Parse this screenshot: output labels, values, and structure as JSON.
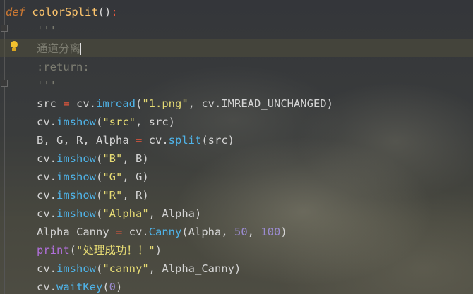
{
  "editor": {
    "lines": [
      {
        "def_kw": "def",
        "func_name": "colorSplit",
        "parens": "()",
        "colon": ":"
      },
      {
        "doc": "'''"
      },
      {
        "doc": "通道分离"
      },
      {
        "doc": ":return:"
      },
      {
        "doc": "'''"
      },
      {
        "var": "src",
        "eq": " = ",
        "obj": "cv.",
        "method": "imread",
        "open": "(",
        "str": "\"1.png\"",
        "rest": ", cv.IMREAD_UNCHANGED)"
      },
      {
        "obj": "cv.",
        "method": "imshow",
        "open": "(",
        "str": "\"src\"",
        "rest": ", src)"
      },
      {
        "var": "B, G, R, Alpha",
        "eq": " = ",
        "obj": "cv.",
        "method": "split",
        "rest": "(src)"
      },
      {
        "obj": "cv.",
        "method": "imshow",
        "open": "(",
        "str": "\"B\"",
        "rest": ", B)"
      },
      {
        "obj": "cv.",
        "method": "imshow",
        "open": "(",
        "str": "\"G\"",
        "rest": ", G)"
      },
      {
        "obj": "cv.",
        "method": "imshow",
        "open": "(",
        "str": "\"R\"",
        "rest": ", R)"
      },
      {
        "obj": "cv.",
        "method": "imshow",
        "open": "(",
        "str": "\"Alpha\"",
        "rest": ", Alpha)"
      },
      {
        "var": "Alpha_Canny",
        "eq": " = ",
        "obj": "cv.",
        "method": "Canny",
        "args_a": "(Alpha, ",
        "n1": "50",
        "sep": ", ",
        "n2": "100",
        "close": ")"
      },
      {
        "builtin": "print",
        "open": "(",
        "str": "\"处理成功！！\"",
        "close": ")"
      },
      {
        "obj": "cv.",
        "method": "imshow",
        "open": "(",
        "str": "\"canny\"",
        "rest": ", Alpha_Canny)"
      },
      {
        "obj": "cv.",
        "method": "waitKey",
        "open": "(",
        "n1": "0",
        "close": ")"
      }
    ],
    "gutter_icons": [
      "fold-icon",
      "intention-bulb-icon",
      "fold-icon"
    ],
    "colors": {
      "keyword": "#cc7832",
      "function_name": "#ffc66d",
      "docstring": "#7e7e72",
      "string": "#e6db74",
      "method": "#4fb3e8",
      "number": "#9b8bd0",
      "operator": "#e8573d",
      "builtin": "#b06fd9",
      "caret_line": "#504e3c"
    }
  }
}
